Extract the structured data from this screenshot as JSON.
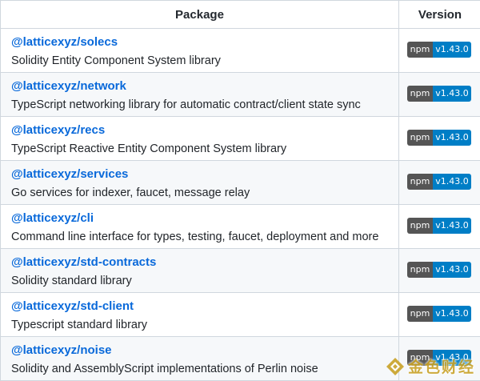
{
  "table": {
    "headers": {
      "package": "Package",
      "version": "Version"
    },
    "rows": [
      {
        "name": "@latticexyz/solecs",
        "description": "Solidity Entity Component System library",
        "badge_label": "npm",
        "badge_version": "v1.43.0"
      },
      {
        "name": "@latticexyz/network",
        "description": "TypeScript networking library for automatic contract/client state sync",
        "badge_label": "npm",
        "badge_version": "v1.43.0"
      },
      {
        "name": "@latticexyz/recs",
        "description": "TypeScript Reactive Entity Component System library",
        "badge_label": "npm",
        "badge_version": "v1.43.0"
      },
      {
        "name": "@latticexyz/services",
        "description": "Go services for indexer, faucet, message relay",
        "badge_label": "npm",
        "badge_version": "v1.43.0"
      },
      {
        "name": "@latticexyz/cli",
        "description": "Command line interface for types, testing, faucet, deployment and more",
        "badge_label": "npm",
        "badge_version": "v1.43.0"
      },
      {
        "name": "@latticexyz/std-contracts",
        "description": "Solidity standard library",
        "badge_label": "npm",
        "badge_version": "v1.43.0"
      },
      {
        "name": "@latticexyz/std-client",
        "description": "Typescript standard library",
        "badge_label": "npm",
        "badge_version": "v1.43.0"
      },
      {
        "name": "@latticexyz/noise",
        "description": "Solidity and AssemblyScript implementations of Perlin noise",
        "badge_label": "npm",
        "badge_version": "v1.43.0"
      }
    ]
  },
  "watermark": {
    "text": "金色财经",
    "color": "#c9a227"
  },
  "colors": {
    "link": "#0969da",
    "badge_left": "#555555",
    "badge_right": "#007ec6",
    "border": "#d0d7de",
    "stripe": "#f6f8fa"
  }
}
